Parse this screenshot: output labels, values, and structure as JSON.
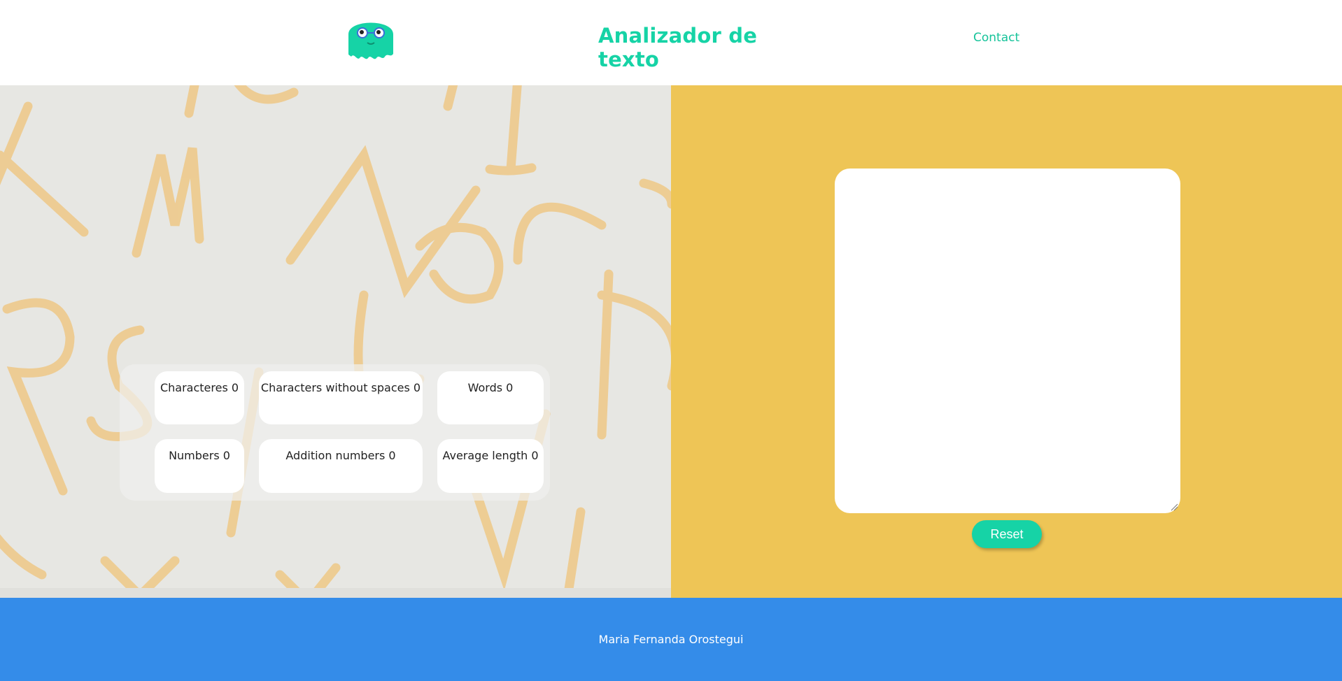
{
  "header": {
    "logo": "ghost-mascot-logo",
    "title": "Analizador de texto",
    "nav_contact": "Contact"
  },
  "stats": {
    "characters": "Characteres 0",
    "characters_no_spaces": "Characters without spaces 0",
    "words": "Words 0",
    "numbers": "Numbers 0",
    "addition_numbers": "Addition numbers 0",
    "average_length": "Average length 0"
  },
  "editor": {
    "value": "",
    "reset_label": "Reset"
  },
  "footer": {
    "author": "Maria Fernanda Orostegui"
  },
  "colors": {
    "accent": "#16d3a6",
    "panel_yellow": "#eec556",
    "footer_blue": "#348ce9",
    "letters": "#efc47a"
  }
}
